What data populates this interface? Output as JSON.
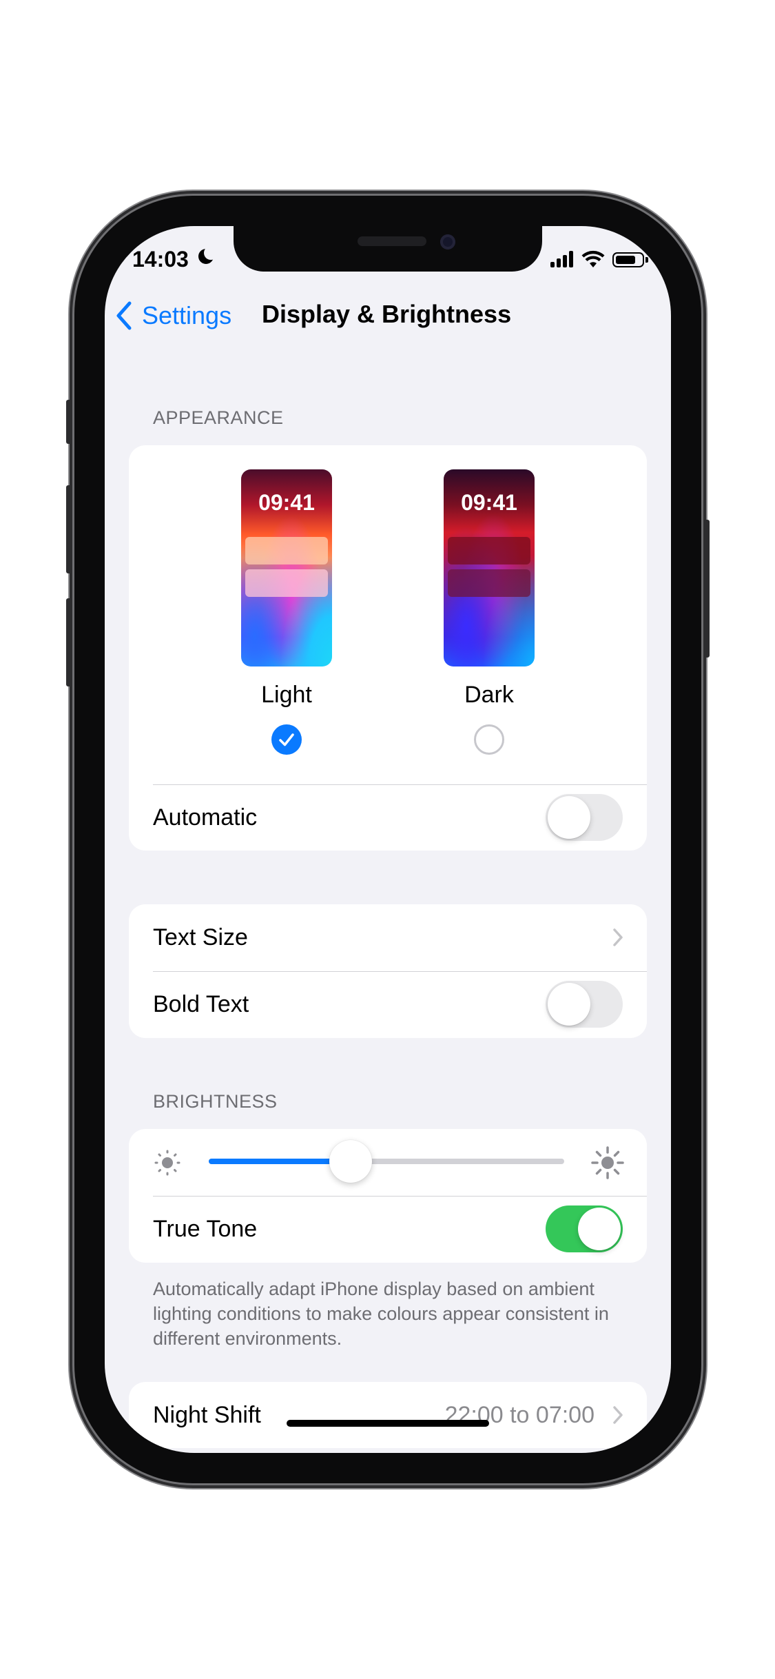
{
  "status_bar": {
    "time": "14:03"
  },
  "nav": {
    "back_label": "Settings",
    "title": "Display & Brightness"
  },
  "appearance": {
    "header": "APPEARANCE",
    "options": [
      {
        "label": "Light",
        "preview_time": "09:41",
        "selected": true
      },
      {
        "label": "Dark",
        "preview_time": "09:41",
        "selected": false
      }
    ],
    "automatic": {
      "label": "Automatic",
      "on": false
    }
  },
  "text": {
    "text_size_label": "Text Size",
    "bold_text": {
      "label": "Bold Text",
      "on": false
    }
  },
  "brightness": {
    "header": "BRIGHTNESS",
    "level": 0.4,
    "true_tone": {
      "label": "True Tone",
      "on": true
    },
    "footnote": "Automatically adapt iPhone display based on ambient lighting conditions to make colours appear consistent in different environments."
  },
  "night_shift": {
    "label": "Night Shift",
    "value": "22:00 to 07:00"
  },
  "colors": {
    "accent": "#0a7aff",
    "toggle_on": "#34c759",
    "group_bg": "#f2f2f7"
  }
}
